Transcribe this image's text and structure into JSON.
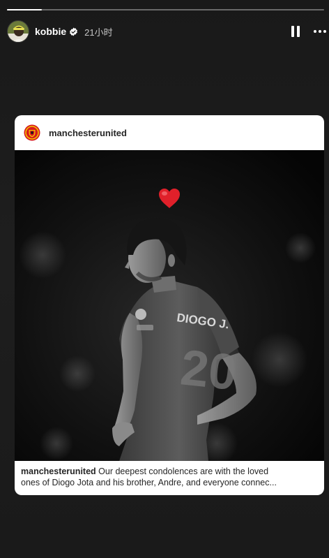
{
  "story": {
    "progress_fraction": 0.11,
    "user": {
      "name": "kobbie",
      "verified": true,
      "avatar": "user-avatar"
    },
    "time_ago": "21小时",
    "controls": {
      "pause": "pause-icon",
      "more": "more-icon"
    }
  },
  "post": {
    "account": "manchesterunited",
    "image": {
      "heart": "red-heart-emoji",
      "jersey_text": "DIOGO J.",
      "jersey_number": "20"
    },
    "caption": {
      "user": "manchesterunited",
      "line1_text": " Our deepest condolences are with the loved",
      "line2_text": "ones of Diogo Jota and his brother, Andre, and everyone connec..."
    }
  },
  "colors": {
    "background": "#1c1c1c",
    "card": "#ffffff",
    "heart": "#e0202a",
    "club_red": "#d7191c",
    "club_gold": "#f3c100"
  }
}
